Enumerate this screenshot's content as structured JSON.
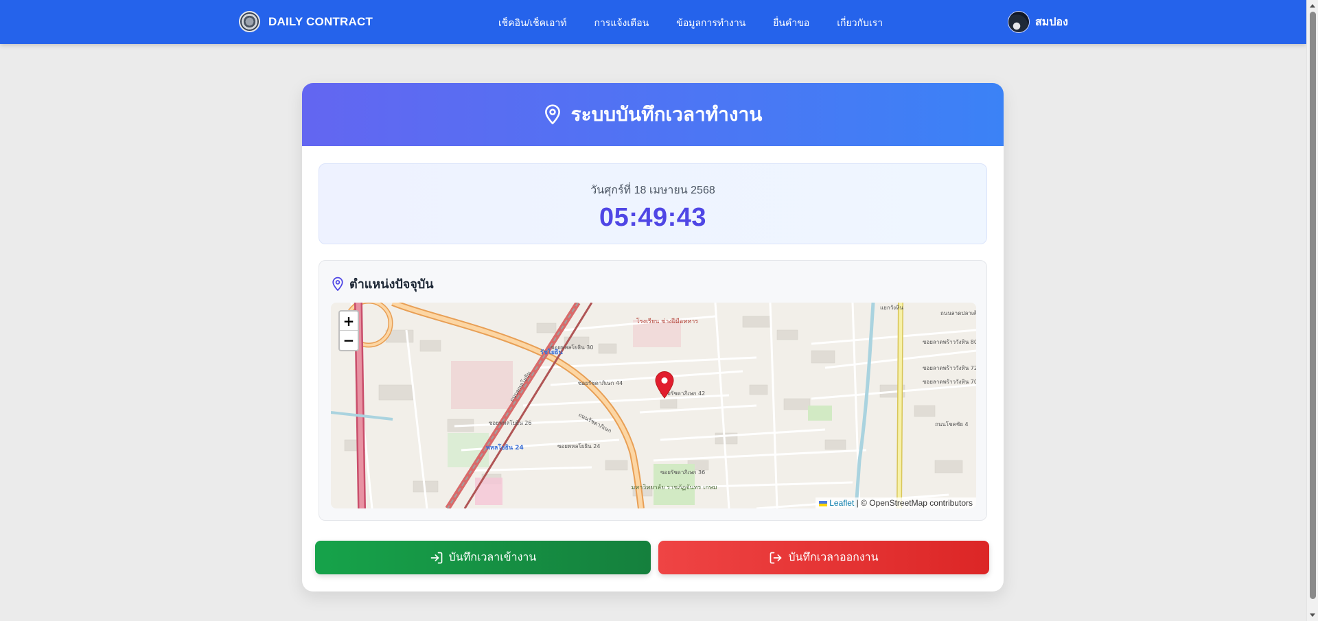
{
  "colors": {
    "navbar": "#2563eb",
    "header_gradient_start": "#6366f1",
    "header_gradient_end": "#3b82f6",
    "clock": "#4f46e5",
    "checkin_button": "#16a34a",
    "checkout_button": "#ef4444"
  },
  "navbar": {
    "brand": "DAILY CONTRACT",
    "links": [
      "เช็คอิน/เช็คเอาท์",
      "การแจ้งเตือน",
      "ข้อมูลการทำงาน",
      "ยื่นคำขอ",
      "เกี่ยวกับเรา"
    ],
    "user_name": "สมปอง"
  },
  "card": {
    "title": "ระบบบันทึกเวลาทำงาน",
    "title_icon": "map-pin-icon",
    "date": "วันศุกร์ที่ 18 เมษายน 2568",
    "time": "05:49:43",
    "location_title": "ตำแหน่งปัจจุบัน",
    "location_icon": "map-pin-icon"
  },
  "map": {
    "zoom_in": "+",
    "zoom_out": "−",
    "attribution_leaflet": "Leaflet",
    "attribution_rest": " | © OpenStreetMap contributors",
    "labels": [
      "ซอยพหลโยธิน 30",
      "ซอยพหลโยธิน 26",
      "ซอยพหลโยธิน 24",
      "ถนนรัชดาภิเษก",
      "ถนนพหลโยธิน",
      "รัชโยธิน",
      "โรงเรียน ช่างฝีมือทหาร",
      "ซอยรัชดาภิเษก 42",
      "ซอยรัชดาภิเษก 36",
      "ซอยรัชดาภิเษก 44",
      "ซอยลาดพร้าววังหิน 80",
      "ซอยลาดพร้าววังหิน 72",
      "ซอยลาดพร้าววังหิน 70",
      "ถนนโชคชัย 4",
      "แยกวังหิน",
      "ถนนลาดปลาเค้า",
      "มหาวิทยาลัย ราชภัฏจันทร เกษม",
      "พหลโยธิน 24"
    ]
  },
  "buttons": {
    "check_in": "บันทึกเวลาเข้างาน",
    "check_out": "บันทึกเวลาออกงาน"
  }
}
